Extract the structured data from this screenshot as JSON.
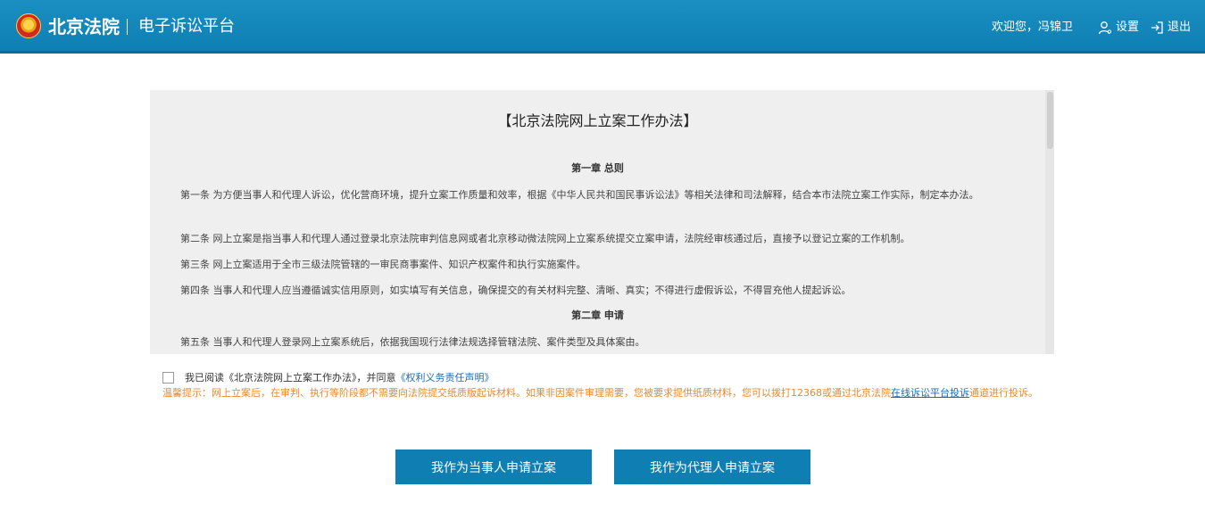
{
  "header": {
    "brand": "北京法院",
    "platform": "电子诉讼平台",
    "welcome": "欢迎您，冯锦卫",
    "settings_label": "设置",
    "logout_label": "退出"
  },
  "document": {
    "title": "【北京法院网上立案工作办法】",
    "chapters": [
      "第一章 总则",
      "第二章 申请"
    ],
    "paragraphs": [
      "第一条 为方便当事人和代理人诉讼，优化营商环境，提升立案工作质量和效率，根据《中华人民共和国民事诉讼法》等相关法律和司法解释，结合本市法院立案工作实际，制定本办法。",
      "第二条 网上立案是指当事人和代理人通过登录北京法院审判信息网或者北京移动微法院网上立案系统提交立案申请，法院经审核通过后，直接予以登记立案的工作机制。",
      "第三条 网上立案适用于全市三级法院管辖的一审民商事案件、知识产权案件和执行实施案件。",
      "第四条 当事人和代理人应当遵循诚实信用原则，如实填写有关信息，确保提交的有关材料完整、清晰、真实；不得进行虚假诉讼，不得冒充他人提起诉讼。",
      "第五条 当事人和代理人登录网上立案系统后，依据我国现行法律法规选择管辖法院、案件类型及具体案由。"
    ]
  },
  "agreement": {
    "text_before": "我已阅读《北京法院网上立案工作办法》，并同意",
    "link_text": "《权利义务责任声明》"
  },
  "tip": {
    "text_before": "温馨提示：网上立案后，在审判、执行等阶段都不需要向法院提交纸质版起诉材料。如果非因案件审理需要，您被要求提供纸质材料，您可以拨打12368或通过北京法院",
    "link_text": "在线诉讼平台投诉",
    "text_after": "通道进行投诉。"
  },
  "buttons": {
    "party": "我作为当事人申请立案",
    "agent": "我作为代理人申请立案"
  },
  "colors": {
    "header": "#0f7fb3",
    "button": "#0f7fb3",
    "link": "#1b6db5",
    "tip": "#e68a2e",
    "doc_bg": "#efefef"
  }
}
